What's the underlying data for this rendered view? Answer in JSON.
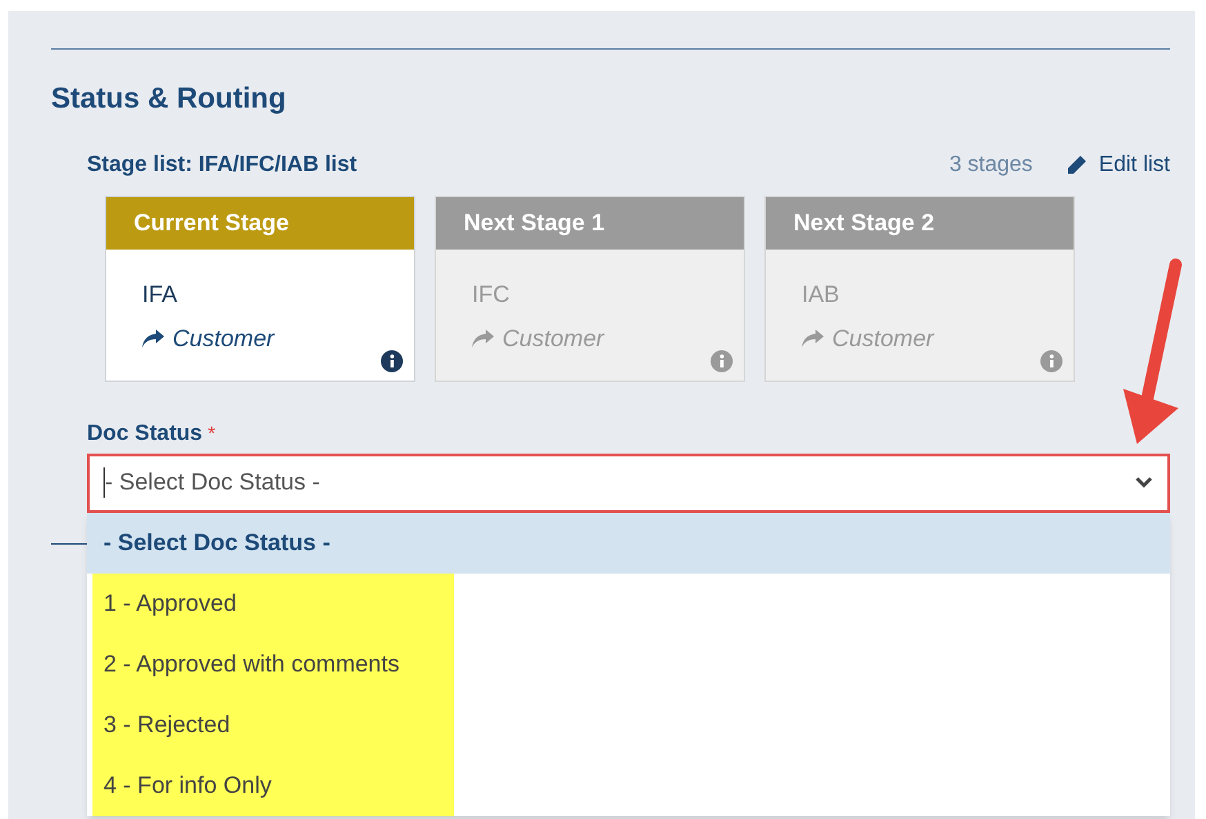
{
  "section": {
    "title": "Status & Routing"
  },
  "stage_list": {
    "label": "Stage list: IFA/IFC/IAB list",
    "count": "3 stages",
    "edit_link": "Edit list"
  },
  "stages": [
    {
      "header": "Current Stage",
      "name": "IFA",
      "route": "Customer",
      "selected": true
    },
    {
      "header": "Next Stage 1",
      "name": "IFC",
      "route": "Customer",
      "selected": false
    },
    {
      "header": "Next Stage 2",
      "name": "IAB",
      "route": "Customer",
      "selected": false
    }
  ],
  "doc_status": {
    "label": "Doc Status",
    "required_mark": "*",
    "placeholder": "- Select Doc Status -",
    "expanded": true,
    "options": [
      {
        "label": "- Select Doc Status -",
        "selected": true,
        "highlighted": false
      },
      {
        "label": "1 - Approved",
        "selected": false,
        "highlighted": true
      },
      {
        "label": "2 - Approved with comments",
        "selected": false,
        "highlighted": true
      },
      {
        "label": "3 - Rejected",
        "selected": false,
        "highlighted": true
      },
      {
        "label": "4 - For info Only",
        "selected": false,
        "highlighted": true
      }
    ]
  }
}
